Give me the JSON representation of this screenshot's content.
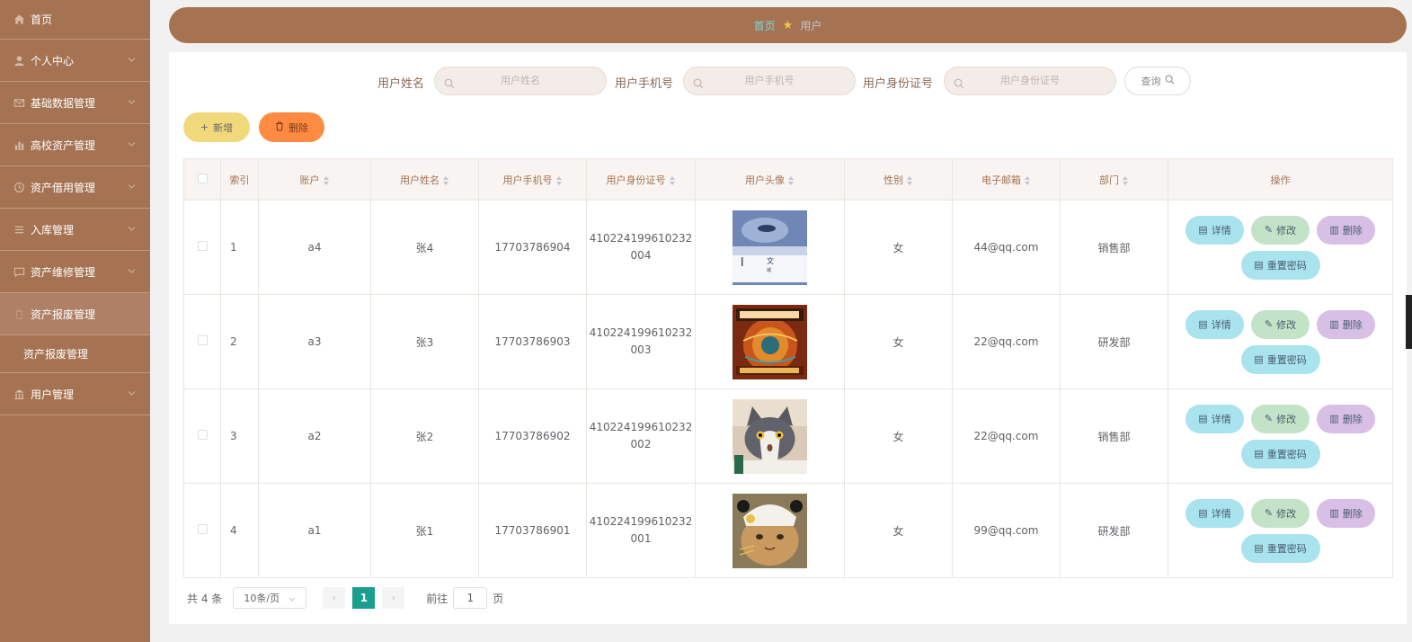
{
  "sidebar": {
    "items": [
      {
        "label": "首页",
        "icon": "home-icon"
      },
      {
        "label": "个人中心",
        "icon": "user-icon"
      },
      {
        "label": "基础数据管理",
        "icon": "mail-icon"
      },
      {
        "label": "高校资产管理",
        "icon": "bar-chart-icon"
      },
      {
        "label": "资产借用管理",
        "icon": "clock-icon"
      },
      {
        "label": "入库管理",
        "icon": "list-icon"
      },
      {
        "label": "资产维修管理",
        "icon": "message-icon"
      },
      {
        "label": "资产报废管理",
        "icon": "trash-icon"
      },
      {
        "label": "资产报废管理",
        "icon": ""
      },
      {
        "label": "用户管理",
        "icon": "bank-icon"
      }
    ]
  },
  "breadcrumb": {
    "home": "首页",
    "current": "用户"
  },
  "search": {
    "name_label": "用户姓名",
    "name_placeholder": "用户姓名",
    "phone_label": "用户手机号",
    "phone_placeholder": "用户手机号",
    "idcard_label": "用户身份证号",
    "idcard_placeholder": "用户身份证号",
    "query_label": "查询"
  },
  "actions": {
    "add_label": "新增",
    "delete_label": "删除"
  },
  "table": {
    "headers": [
      "索引",
      "账户",
      "用户姓名",
      "用户手机号",
      "用户身份证号",
      "用户头像",
      "性别",
      "电子邮箱",
      "部门",
      "操作"
    ],
    "rows": [
      {
        "index": "1",
        "account": "a4",
        "name": "张4",
        "phone": "17703786904",
        "idcard_1": "410224199610232",
        "idcard_2": "004",
        "gender": "女",
        "email": "44@qq.com",
        "dept": "销售部"
      },
      {
        "index": "2",
        "account": "a3",
        "name": "张3",
        "phone": "17703786903",
        "idcard_1": "410224199610232",
        "idcard_2": "003",
        "gender": "女",
        "email": "22@qq.com",
        "dept": "研发部"
      },
      {
        "index": "3",
        "account": "a2",
        "name": "张2",
        "phone": "17703786902",
        "idcard_1": "410224199610232",
        "idcard_2": "002",
        "gender": "女",
        "email": "22@qq.com",
        "dept": "销售部"
      },
      {
        "index": "4",
        "account": "a1",
        "name": "张1",
        "phone": "17703786901",
        "idcard_1": "410224199610232",
        "idcard_2": "001",
        "gender": "女",
        "email": "99@qq.com",
        "dept": "研发部"
      }
    ],
    "ops": {
      "detail": "详情",
      "edit": "修改",
      "delete": "删除",
      "reset": "重置密码"
    }
  },
  "pagination": {
    "total": "共 4 条",
    "page_size": "10条/页",
    "current": "1",
    "goto_label": "前往",
    "goto_value": "1",
    "page_suffix": "页"
  },
  "colors": {
    "brand": "#a57352",
    "page_active": "#1a9f8f",
    "add": "#f1d97b",
    "delete": "#ff8a42"
  }
}
